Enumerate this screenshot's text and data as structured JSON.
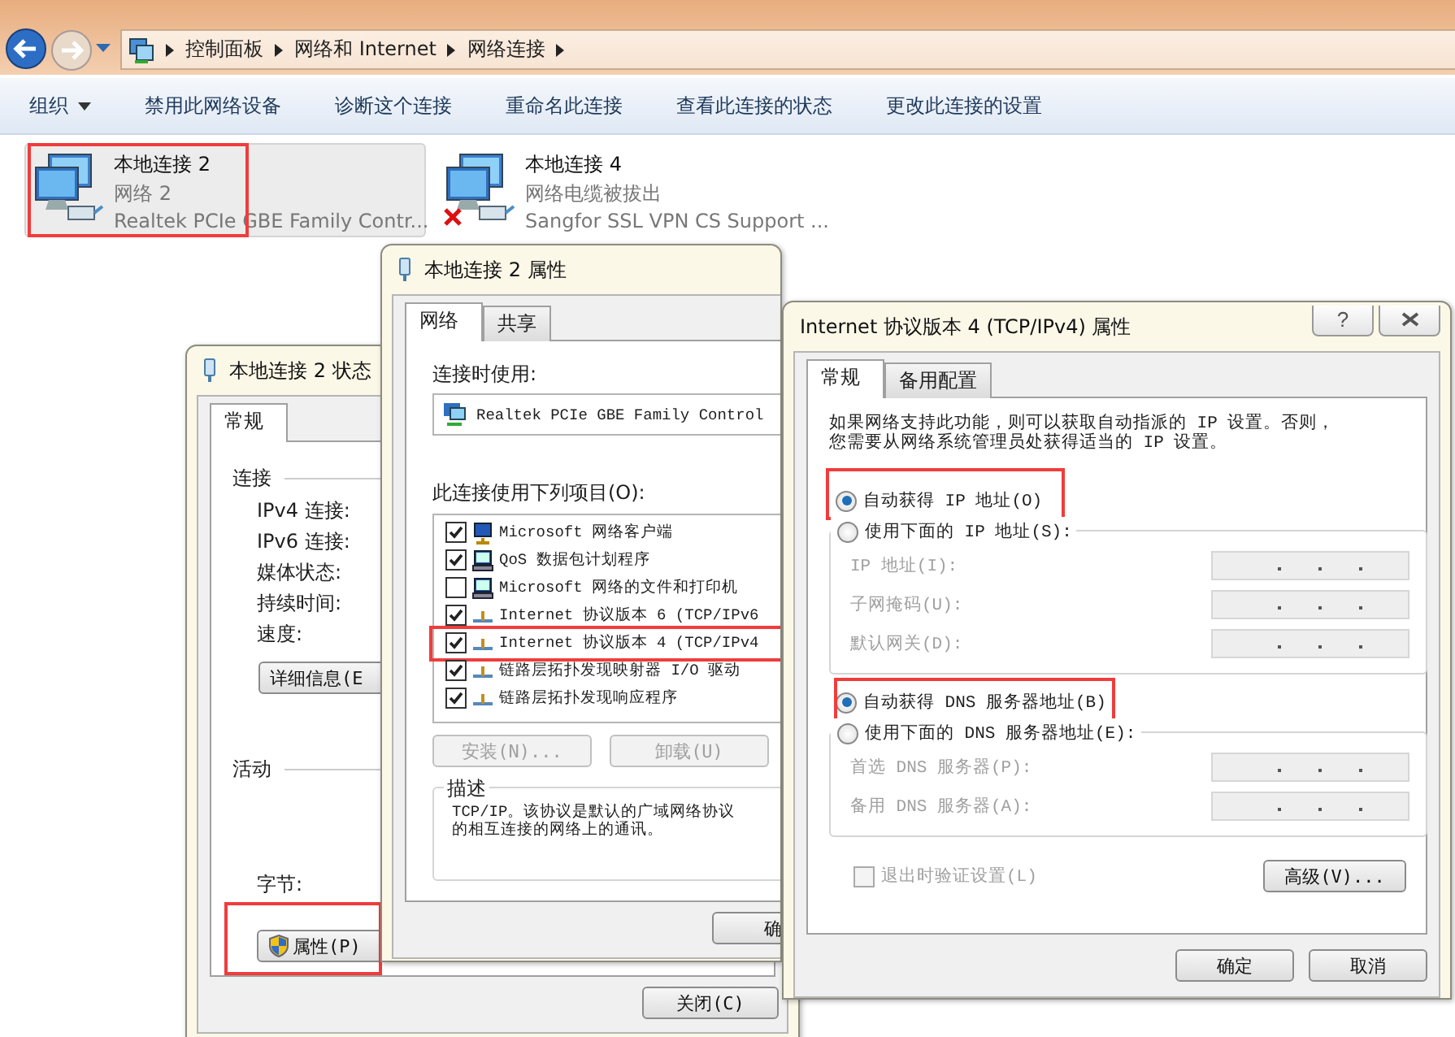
{
  "explorer": {
    "breadcrumbs": [
      "控制面板",
      "网络和 Internet",
      "网络连接"
    ],
    "toolbar": [
      {
        "label": "组织",
        "kind": "menu"
      },
      {
        "label": "禁用此网络设备",
        "kind": "command"
      },
      {
        "label": "诊断这个连接",
        "kind": "command"
      },
      {
        "label": "重命名此连接",
        "kind": "command"
      },
      {
        "label": "查看此连接的状态",
        "kind": "command"
      },
      {
        "label": "更改此连接的设置",
        "kind": "command"
      }
    ],
    "connections": [
      {
        "name": "本地连接 2",
        "network": "网络  2",
        "adapter": "Realtek PCIe GBE Family Contr...",
        "selected": true,
        "disconnected": false,
        "highlighted": true
      },
      {
        "name": "本地连接 4",
        "network": "网络电缆被拔出",
        "adapter": "Sangfor SSL VPN CS Support ...",
        "selected": false,
        "disconnected": true,
        "highlighted": false
      }
    ]
  },
  "status_dialog": {
    "title": "本地连接 2 状态",
    "tabs": [
      {
        "label": "常规",
        "selected": true
      }
    ],
    "connection_heading": "连接",
    "connection_fields": [
      "IPv4 连接:",
      "IPv6 连接:",
      "媒体状态:",
      "持续时间:",
      "速度:"
    ],
    "details_button": "详细信息(E",
    "activity_heading": "活动",
    "bytes_label": "字节:",
    "properties_button": {
      "label": "属性(P)",
      "highlighted": true
    },
    "close_button": "关闭(C)"
  },
  "properties_dialog": {
    "title": "本地连接 2 属性",
    "tabs": [
      {
        "label": "网络",
        "selected": true
      },
      {
        "label": "共享",
        "selected": false
      }
    ],
    "connect_using_label": "连接时使用:",
    "adapter": "Realtek PCIe GBE Family Control",
    "items_label": "此连接使用下列项目(O):",
    "items": [
      {
        "label": "Microsoft 网络客户端",
        "checked": true,
        "kind": "client",
        "highlighted": false
      },
      {
        "label": "QoS 数据包计划程序",
        "checked": true,
        "kind": "service",
        "highlighted": false
      },
      {
        "label": "Microsoft 网络的文件和打印机",
        "checked": false,
        "kind": "service",
        "highlighted": false
      },
      {
        "label": "Internet 协议版本 6 (TCP/IPv6",
        "checked": true,
        "kind": "protocol",
        "highlighted": false
      },
      {
        "label": "Internet 协议版本 4 (TCP/IPv4",
        "checked": true,
        "kind": "protocol",
        "highlighted": true
      },
      {
        "label": "链路层拓扑发现映射器 I/O 驱动",
        "checked": true,
        "kind": "protocol",
        "highlighted": false
      },
      {
        "label": "链路层拓扑发现响应程序",
        "checked": true,
        "kind": "protocol",
        "highlighted": false
      }
    ],
    "buttons": [
      {
        "label": "安装(N)...",
        "disabled": true
      },
      {
        "label": "卸载(U)",
        "disabled": true
      }
    ],
    "description_heading": "描述",
    "description_lines": [
      "TCP/IP。该协议是默认的广域网络协议",
      "的相互连接的网络上的通讯。"
    ],
    "ok_button": "确"
  },
  "ipv4_dialog": {
    "title": "Internet 协议版本 4 (TCP/IPv4) 属性",
    "help_button": "?",
    "tabs": [
      {
        "label": "常规",
        "selected": true
      },
      {
        "label": "备用配置",
        "selected": false
      }
    ],
    "intro_lines": [
      "如果网络支持此功能，则可以获取自动指派的 IP 设置。否则，",
      "您需要从网络系统管理员处获得适当的 IP 设置。"
    ],
    "ip_options": [
      {
        "label": "自动获得 IP 地址(O)",
        "selected": true,
        "highlighted": true
      },
      {
        "label": "使用下面的 IP 地址(S):",
        "selected": false,
        "highlighted": false
      }
    ],
    "ip_fields": [
      {
        "label": "IP 地址(I):",
        "disabled": true
      },
      {
        "label": "子网掩码(U):",
        "disabled": true
      },
      {
        "label": "默认网关(D):",
        "disabled": true
      }
    ],
    "dns_options": [
      {
        "label": "自动获得 DNS 服务器地址(B)",
        "selected": true,
        "highlighted": true
      },
      {
        "label": "使用下面的 DNS 服务器地址(E):",
        "selected": false,
        "highlighted": false
      }
    ],
    "dns_fields": [
      {
        "label": "首选 DNS 服务器(P):",
        "disabled": true
      },
      {
        "label": "备用 DNS 服务器(A):",
        "disabled": true
      }
    ],
    "validate_checkbox": {
      "label": "退出时验证设置(L)",
      "checked": false,
      "disabled": true
    },
    "advanced_button": "高级(V)...",
    "ok_button": "确定",
    "cancel_button": "取消"
  }
}
